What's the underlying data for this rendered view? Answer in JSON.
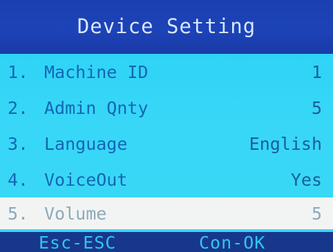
{
  "header": {
    "title": "Device Setting"
  },
  "menu": {
    "items": [
      {
        "num": "1.",
        "label": "Machine ID",
        "value": "1",
        "selected": false
      },
      {
        "num": "2.",
        "label": "Admin Qnty",
        "value": "5",
        "selected": false
      },
      {
        "num": "3.",
        "label": "Language",
        "value": "English",
        "selected": false
      },
      {
        "num": "4.",
        "label": "VoiceOut",
        "value": "Yes",
        "selected": false
      },
      {
        "num": "5.",
        "label": "Volume",
        "value": "5",
        "selected": true
      }
    ]
  },
  "footer": {
    "esc_label": "Esc-ESC",
    "ok_label": "Con-OK"
  },
  "colors": {
    "header_bg": "#1c43b8",
    "body_bg": "#38d7f7",
    "text": "#1466b4",
    "selected_bg": "#f2f4f3",
    "footer_bg": "#17378c",
    "footer_text": "#2fc6ef"
  }
}
